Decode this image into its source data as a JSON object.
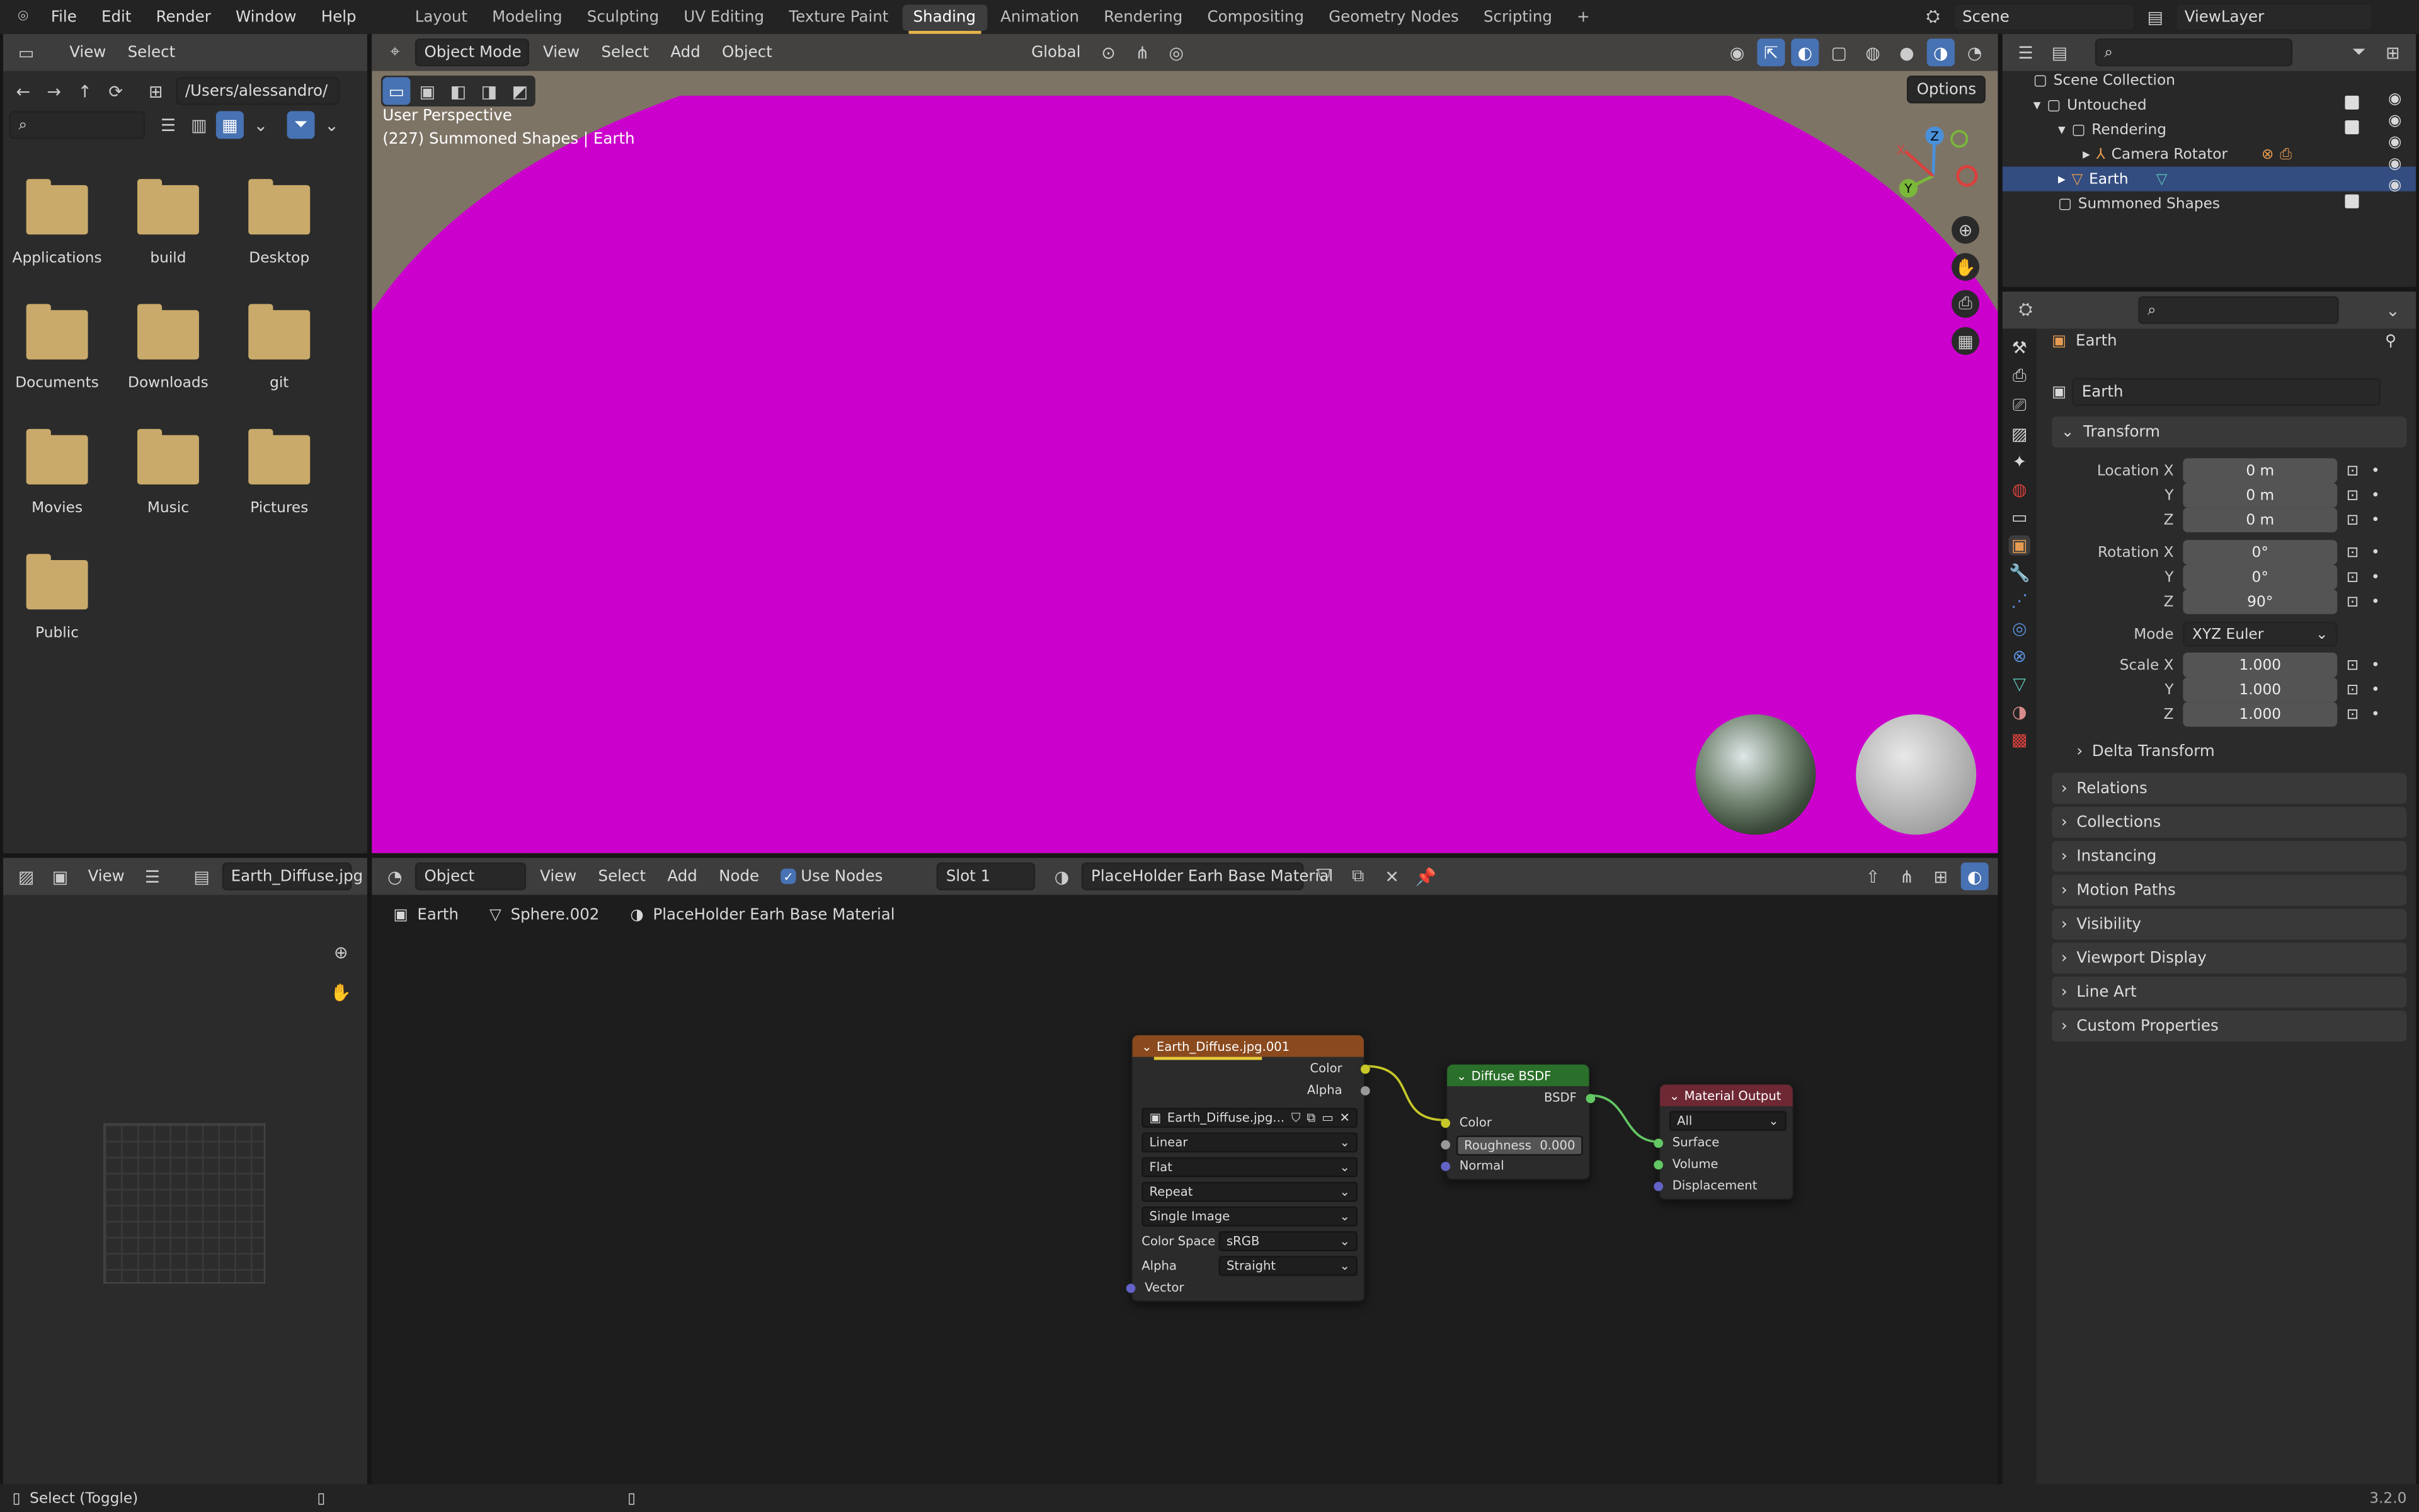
{
  "topbar": {
    "menus": [
      "File",
      "Edit",
      "Render",
      "Window",
      "Help"
    ],
    "workspaces": [
      "Layout",
      "Modeling",
      "Sculpting",
      "UV Editing",
      "Texture Paint",
      "Shading",
      "Animation",
      "Rendering",
      "Compositing",
      "Geometry Nodes",
      "Scripting"
    ],
    "active_workspace": "Shading",
    "add_tab": "+",
    "scene": "Scene",
    "view_layer": "ViewLayer"
  },
  "file_browser": {
    "menus": [
      "View",
      "Select"
    ],
    "path": "/Users/alessandro/",
    "folders": [
      "Applications",
      "build",
      "Desktop",
      "Documents",
      "Downloads",
      "git",
      "Movies",
      "Music",
      "Pictures",
      "Public"
    ]
  },
  "viewport": {
    "mode": "Object Mode",
    "menus": [
      "View",
      "Select",
      "Add",
      "Object"
    ],
    "orientation": "Global",
    "options": "Options",
    "perspective": "User Perspective",
    "info": "(227) Summoned Shapes | Earth",
    "gizmo": {
      "x": "X",
      "y": "Y",
      "z": "Z"
    },
    "bg_color": "#cc00cc"
  },
  "image_editor": {
    "menus": [
      "View"
    ],
    "image": "Earth_Diffuse.jpg"
  },
  "node_editor": {
    "type": "Object",
    "menus": [
      "View",
      "Select",
      "Add",
      "Node"
    ],
    "use_nodes": "Use Nodes",
    "slot": "Slot 1",
    "material": "PlaceHolder Earh Base Material",
    "breadcrumb": [
      "Earth",
      "Sphere.002",
      "PlaceHolder Earh Base Material"
    ],
    "image_node": {
      "title": "Earth_Diffuse.jpg.001",
      "outputs": [
        "Color",
        "Alpha"
      ],
      "image": "Earth_Diffuse.jpg...",
      "interpolation": "Linear",
      "projection": "Flat",
      "extension": "Repeat",
      "source": "Single Image",
      "color_space_label": "Color Space",
      "color_space": "sRGB",
      "alpha_label": "Alpha",
      "alpha": "Straight",
      "input": "Vector"
    },
    "diffuse_node": {
      "title": "Diffuse BSDF",
      "output": "BSDF",
      "inputs": [
        "Color",
        "Normal"
      ],
      "roughness_label": "Roughness",
      "roughness": "0.000"
    },
    "output_node": {
      "title": "Material Output",
      "target": "All",
      "inputs": [
        "Surface",
        "Volume",
        "Displacement"
      ]
    }
  },
  "outliner": {
    "items": [
      {
        "label": "Scene Collection"
      },
      {
        "label": "Untouched"
      },
      {
        "label": "Rendering"
      },
      {
        "label": "Camera Rotator"
      },
      {
        "label": "Earth"
      },
      {
        "label": "Summoned Shapes"
      }
    ]
  },
  "properties": {
    "object_name": "Earth",
    "data_name": "Earth",
    "transform_label": "Transform",
    "location_label": "Location X",
    "rotation_label": "Rotation X",
    "scale_label": "Scale X",
    "axis_y": "Y",
    "axis_z": "Z",
    "location": [
      "0 m",
      "0 m",
      "0 m"
    ],
    "rotation": [
      "0°",
      "0°",
      "90°"
    ],
    "mode_label": "Mode",
    "mode": "XYZ Euler",
    "scale": [
      "1.000",
      "1.000",
      "1.000"
    ],
    "delta": "Delta Transform",
    "sections": [
      "Relations",
      "Collections",
      "Instancing",
      "Motion Paths",
      "Visibility",
      "Viewport Display",
      "Line Art",
      "Custom Properties"
    ]
  },
  "status": {
    "left": "Select (Toggle)",
    "version": "3.2.0"
  }
}
